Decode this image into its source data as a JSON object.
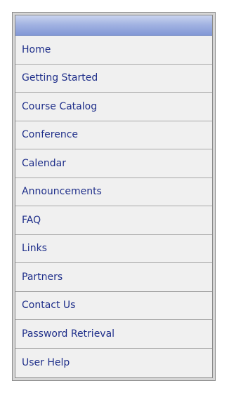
{
  "nav": {
    "items": [
      {
        "label": "Home"
      },
      {
        "label": "Getting Started"
      },
      {
        "label": "Course Catalog"
      },
      {
        "label": "Conference"
      },
      {
        "label": "Calendar"
      },
      {
        "label": "Announcements"
      },
      {
        "label": "FAQ"
      },
      {
        "label": "Links"
      },
      {
        "label": "Partners"
      },
      {
        "label": "Contact Us"
      },
      {
        "label": "Password Retrieval"
      },
      {
        "label": "User Help"
      }
    ]
  },
  "colors": {
    "header_gradient_top": "#c9d3ef",
    "header_gradient_bottom": "#8297d6",
    "link_text": "#1f2f8a",
    "item_background": "#f0f0f0",
    "divider": "#a8a8a8"
  }
}
